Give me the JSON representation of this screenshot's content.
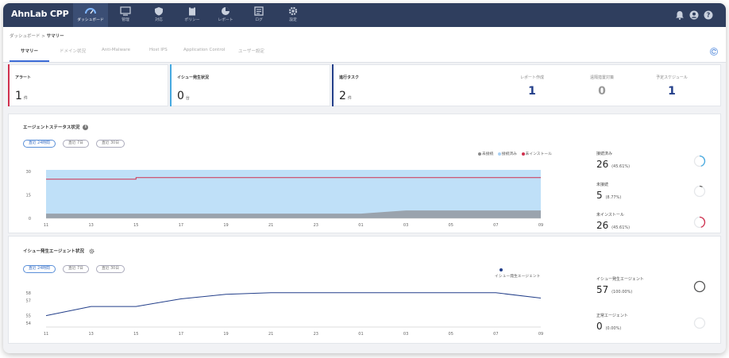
{
  "app": {
    "title": "AhnLab CPP"
  },
  "nav": [
    {
      "label": "ダッシュボード",
      "icon": "dashboard-icon",
      "active": true
    },
    {
      "label": "管理",
      "icon": "monitor-icon"
    },
    {
      "label": "対応",
      "icon": "shield-icon"
    },
    {
      "label": "ポリシー",
      "icon": "clipboard-icon"
    },
    {
      "label": "レポート",
      "icon": "pie-chart-icon"
    },
    {
      "label": "ログ",
      "icon": "log-icon"
    },
    {
      "label": "設定",
      "icon": "gear-icon"
    }
  ],
  "topright": {
    "icons": [
      "bell-icon",
      "user-icon",
      "help-icon"
    ]
  },
  "breadcrumb": {
    "root": "ダッシュボード",
    "sep": ">",
    "current": "サマリー"
  },
  "tabs": [
    "サマリー",
    "ドメイン状況",
    "Anti-Malware",
    "Host IPS",
    "Application Control",
    "ユーザー設定"
  ],
  "summary": {
    "alert": {
      "title": "アラート",
      "value": "1",
      "unit": "件",
      "color": "#d0304e"
    },
    "issue": {
      "title": "イシュー発生状況",
      "value": "0",
      "unit": "台",
      "color": "#46a9e0"
    },
    "task": {
      "title": "進行タスク",
      "value": "2",
      "unit": "件",
      "color": "#233f8a"
    },
    "stats": [
      {
        "label": "レポート作成",
        "value": "1",
        "color": "#233f8a"
      },
      {
        "label": "遠隔措置対策",
        "value": "0",
        "color": "#999999"
      },
      {
        "label": "予定スケジュール",
        "value": "1",
        "color": "#233f8a"
      }
    ]
  },
  "agent_status": {
    "title": "エージェントステータス状況",
    "info": "i",
    "periods": [
      "直近 24時間",
      "直近 7日",
      "直近 30日"
    ],
    "legend": [
      "未接続",
      "接続済み",
      "未インストール"
    ],
    "legend_colors": [
      "#888888",
      "#a8d1f5",
      "#d0304e"
    ],
    "stats": [
      {
        "label": "接続済み",
        "value": "26",
        "pct": "(45.61%)",
        "ring_color": "#46a9e0",
        "fraction": 0.4561
      },
      {
        "label": "未接続",
        "value": "5",
        "pct": "(8.77%)",
        "ring_color": "#666666",
        "fraction": 0.0877
      },
      {
        "label": "未インストール",
        "value": "26",
        "pct": "(45.61%)",
        "ring_color": "#d0304e",
        "fraction": 0.4561
      }
    ]
  },
  "issue_agents": {
    "title": "イシュー発生エージェント状況",
    "periods": [
      "直近 24時間",
      "直近 7日",
      "直近 30日"
    ],
    "legend": [
      "イシュー発生エージェント"
    ],
    "legend_colors": [
      "#233f8a"
    ],
    "stats": [
      {
        "label": "イシュー発生エージェント",
        "value": "57",
        "pct": "(100.00%)",
        "ring_color": "#555555",
        "fraction": 1.0
      },
      {
        "label": "正常エージェント",
        "value": "0",
        "pct": "(0.00%)",
        "ring_color": "#cccccc",
        "fraction": 0.0
      }
    ]
  },
  "chart_data": [
    {
      "type": "area",
      "title": "エージェントステータス状況",
      "x": [
        "11",
        "13",
        "15",
        "17",
        "19",
        "21",
        "23",
        "01",
        "03",
        "05",
        "07",
        "09"
      ],
      "yticks": [
        0,
        15,
        30
      ],
      "ylim": [
        0,
        33
      ],
      "grid": false,
      "legend_position": "top-right",
      "series": [
        {
          "name": "接続済み",
          "values": [
            31,
            31,
            31,
            31,
            31,
            31,
            31,
            31,
            31,
            31,
            31,
            31
          ]
        },
        {
          "name": "未接続",
          "values": [
            3,
            3,
            3,
            3,
            3,
            3,
            3,
            3,
            5,
            5,
            5,
            5
          ]
        },
        {
          "name": "未インストール",
          "values": [
            25,
            25,
            26,
            26,
            26,
            26,
            26,
            26,
            26,
            26,
            26,
            26
          ]
        }
      ]
    },
    {
      "type": "line",
      "title": "イシュー発生エージェント状況",
      "x": [
        "11",
        "13",
        "15",
        "17",
        "19",
        "21",
        "23",
        "01",
        "03",
        "05",
        "07",
        "09"
      ],
      "yticks": [
        54,
        55,
        57,
        58
      ],
      "ylim": [
        53.5,
        58.5
      ],
      "grid": false,
      "legend_position": "top-right",
      "series": [
        {
          "name": "イシュー発生エージェント",
          "values": [
            55,
            56.2,
            56.2,
            57.2,
            57.8,
            58,
            58,
            58,
            58,
            58,
            58,
            57.3
          ]
        }
      ]
    }
  ]
}
